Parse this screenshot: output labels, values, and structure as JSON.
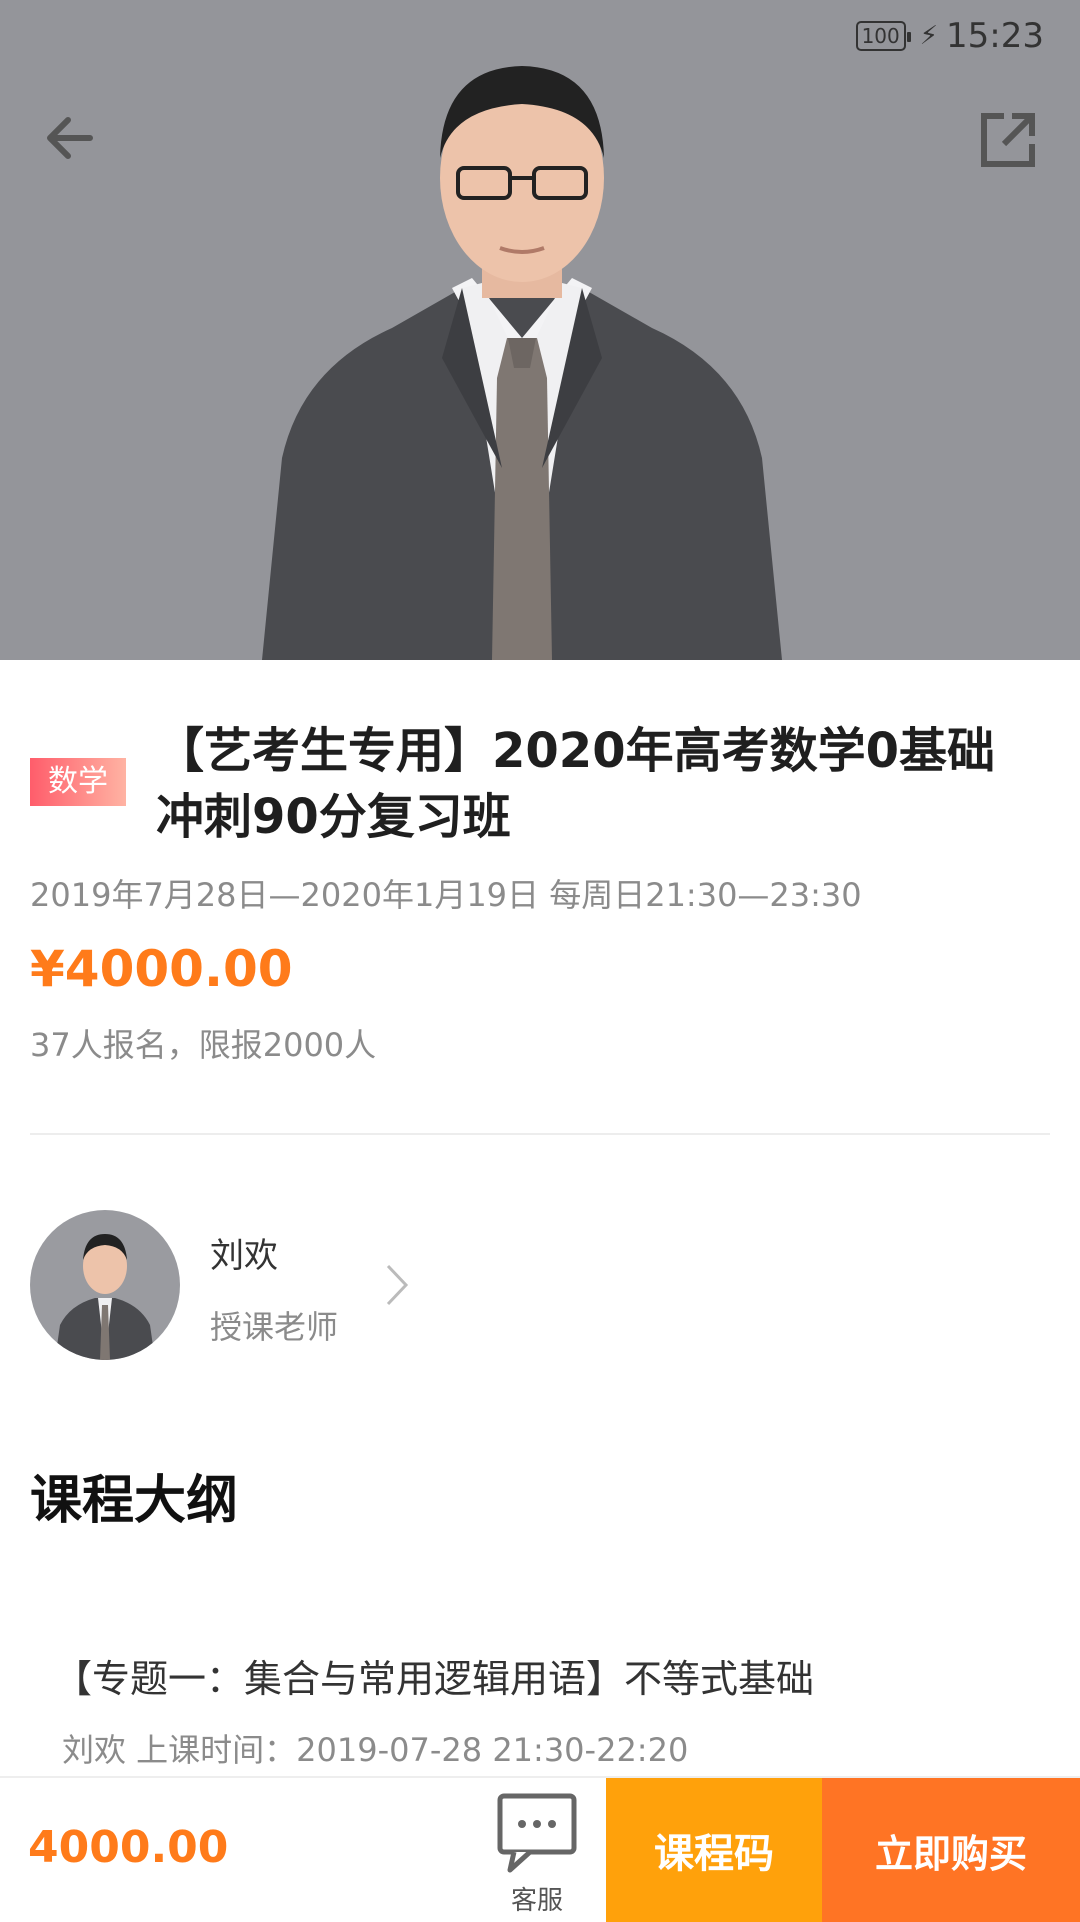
{
  "status_bar": {
    "battery": "100",
    "time": "15:23"
  },
  "header": {
    "back_icon": "arrow-left-icon",
    "share_icon": "share-external-icon"
  },
  "course": {
    "subject_tag": "数学",
    "title": "【艺考生专用】2020年高考数学0基础冲刺90分复习班",
    "schedule": "2019年7月28日—2020年1月19日  每周日21:30—23:30",
    "price": "¥4000.00",
    "enrollment": "37人报名，限报2000人"
  },
  "teacher": {
    "name": "刘欢",
    "role": "授课老师"
  },
  "outline": {
    "heading": "课程大纲",
    "lessons": [
      {
        "title": "【专题一：集合与常用逻辑用语】不等式基础",
        "meta": "刘欢  上课时间：2019-07-28 21:30-22:20"
      }
    ]
  },
  "bottom_bar": {
    "price": "4000.00",
    "service_label": "客服",
    "service_icon": "chat-bubble-icon",
    "course_code_label": "课程码",
    "buy_label": "立即购买"
  },
  "colors": {
    "accent_orange": "#ff7b1a",
    "code_button": "#ffa10b",
    "buy_button": "#ff7424",
    "hero_background": "#94959a",
    "tag_gradient_start": "#ff5d6b"
  }
}
